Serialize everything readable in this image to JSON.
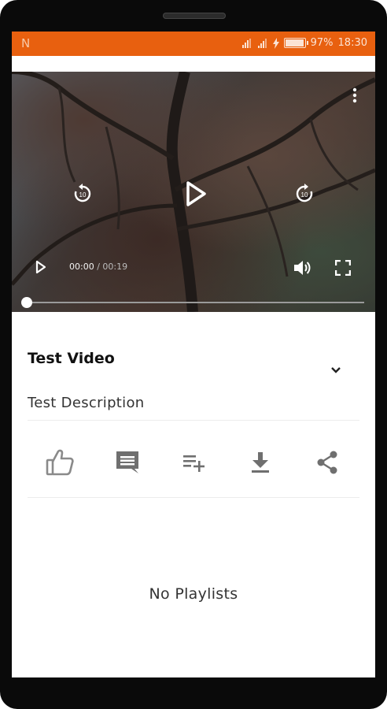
{
  "status_bar": {
    "notification_glyph": "N",
    "battery_percent": "97%",
    "time": "18:30",
    "bg_color": "#e8600f"
  },
  "player": {
    "current_time": "00:00",
    "separator": " / ",
    "duration": "00:19",
    "progress": 0.0,
    "icons": [
      "more-vert-icon",
      "replay-10-icon",
      "play-icon",
      "forward-10-icon",
      "play-small-icon",
      "volume-icon",
      "fullscreen-icon"
    ]
  },
  "video_info": {
    "title": "Test Video",
    "description": "Test Description"
  },
  "actions": [
    "like-icon",
    "comment-icon",
    "add-to-playlist-icon",
    "download-icon",
    "share-icon"
  ],
  "playlists": {
    "empty_text": "No Playlists"
  }
}
